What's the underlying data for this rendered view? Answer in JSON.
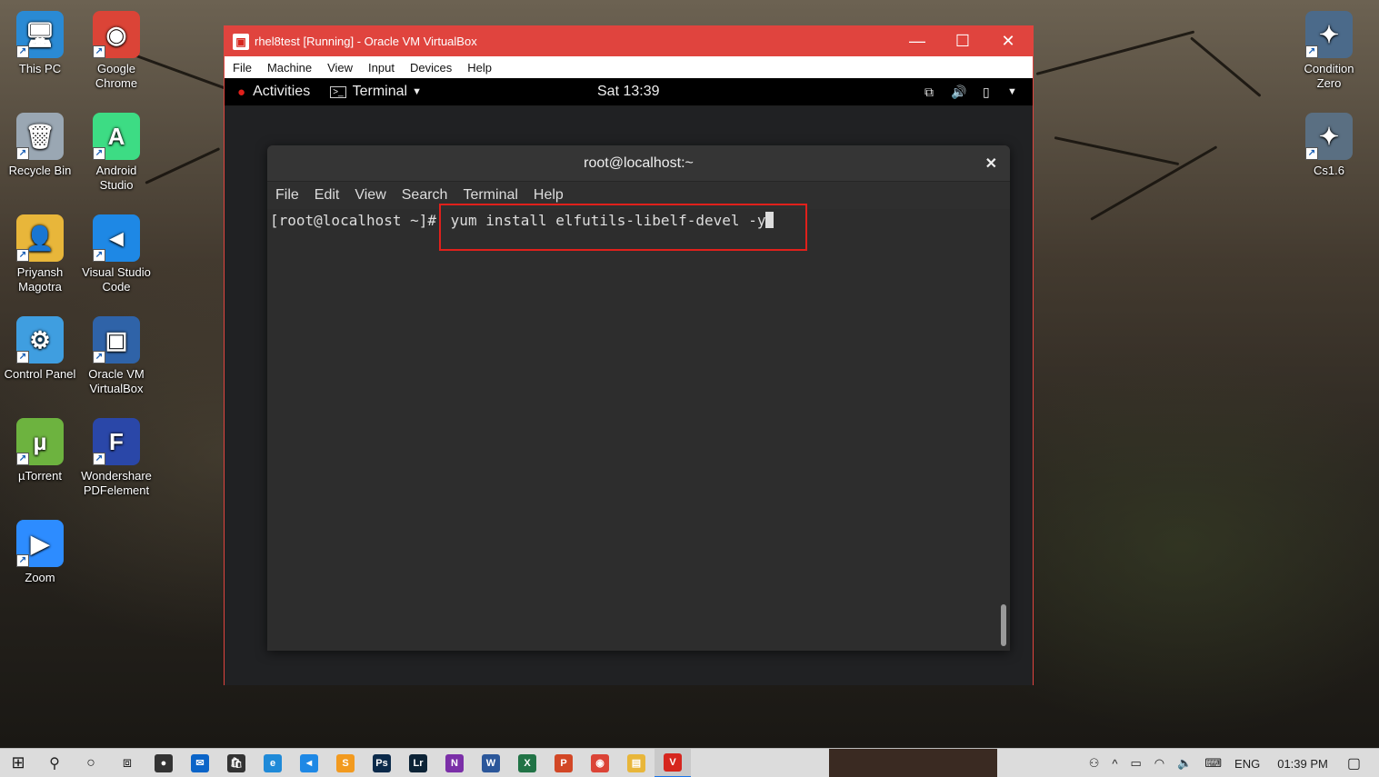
{
  "desktop": {
    "icons_left": [
      {
        "label": "This PC",
        "icon": "this-pc-icon",
        "color": "#2a8ad4"
      },
      {
        "label": "Google Chrome",
        "icon": "chrome-icon",
        "color": "#db4437"
      },
      {
        "label": "Recycle Bin",
        "icon": "recycle-bin-icon",
        "color": "#9aa7b3"
      },
      {
        "label": "Android Studio",
        "icon": "android-studio-icon",
        "color": "#3ddc84"
      },
      {
        "label": "Priyansh Magotra",
        "icon": "user-folder-icon",
        "color": "#e8b63a"
      },
      {
        "label": "Visual Studio Code",
        "icon": "vscode-icon",
        "color": "#1e88e5"
      },
      {
        "label": "Control Panel",
        "icon": "control-panel-icon",
        "color": "#3f9ee0"
      },
      {
        "label": "Oracle VM VirtualBox",
        "icon": "virtualbox-icon",
        "color": "#2f63a8"
      },
      {
        "label": "µTorrent",
        "icon": "utorrent-icon",
        "color": "#6db33f"
      },
      {
        "label": "Wondershare PDFelement",
        "icon": "pdfelement-icon",
        "color": "#2a47a8"
      },
      {
        "label": "Zoom",
        "icon": "zoom-icon",
        "color": "#2d8cff"
      }
    ],
    "icons_right": [
      {
        "label": "Condition Zero",
        "icon": "condition-zero-icon",
        "color": "#4b6a8a"
      },
      {
        "label": "Cs1.6",
        "icon": "cs16-icon",
        "color": "#5a6f82"
      }
    ]
  },
  "vbox": {
    "title": "rhel8test [Running] - Oracle VM VirtualBox",
    "menu": [
      "File",
      "Machine",
      "View",
      "Input",
      "Devices",
      "Help"
    ],
    "accent": "#e0443e"
  },
  "gnome": {
    "activities": "Activities",
    "app_menu": "Terminal",
    "clock": "Sat 13:39"
  },
  "terminal": {
    "title": "root@localhost:~",
    "menu": [
      "File",
      "Edit",
      "View",
      "Search",
      "Terminal",
      "Help"
    ],
    "prompt": "[root@localhost ~]#",
    "command": "yum install elfutils-libelf-devel -y",
    "highlight_color": "#e0201b"
  },
  "taskbar": {
    "apps": [
      {
        "name": "obs",
        "color": "#333333",
        "glyph": "●"
      },
      {
        "name": "mail",
        "color": "#0a64c8",
        "glyph": "✉"
      },
      {
        "name": "store",
        "color": "#333333",
        "glyph": "🛍"
      },
      {
        "name": "edge",
        "color": "#1f8ad8",
        "glyph": "e"
      },
      {
        "name": "vscode",
        "color": "#1e88e5",
        "glyph": "◄"
      },
      {
        "name": "sublime",
        "color": "#f29a1f",
        "glyph": "S"
      },
      {
        "name": "photoshop",
        "color": "#0b2a4a",
        "glyph": "Ps"
      },
      {
        "name": "lightroom",
        "color": "#0c2336",
        "glyph": "Lr"
      },
      {
        "name": "onenote",
        "color": "#7b2fa8",
        "glyph": "N"
      },
      {
        "name": "word",
        "color": "#2b579a",
        "glyph": "W"
      },
      {
        "name": "excel",
        "color": "#217346",
        "glyph": "X"
      },
      {
        "name": "powerpoint",
        "color": "#d24726",
        "glyph": "P"
      },
      {
        "name": "chrome",
        "color": "#db4437",
        "glyph": "◉"
      },
      {
        "name": "file-explorer",
        "color": "#e8b63a",
        "glyph": "▤"
      },
      {
        "name": "virtualbox",
        "color": "#d6261e",
        "glyph": "V"
      }
    ],
    "language": "ENG",
    "time": "01:39 PM"
  }
}
